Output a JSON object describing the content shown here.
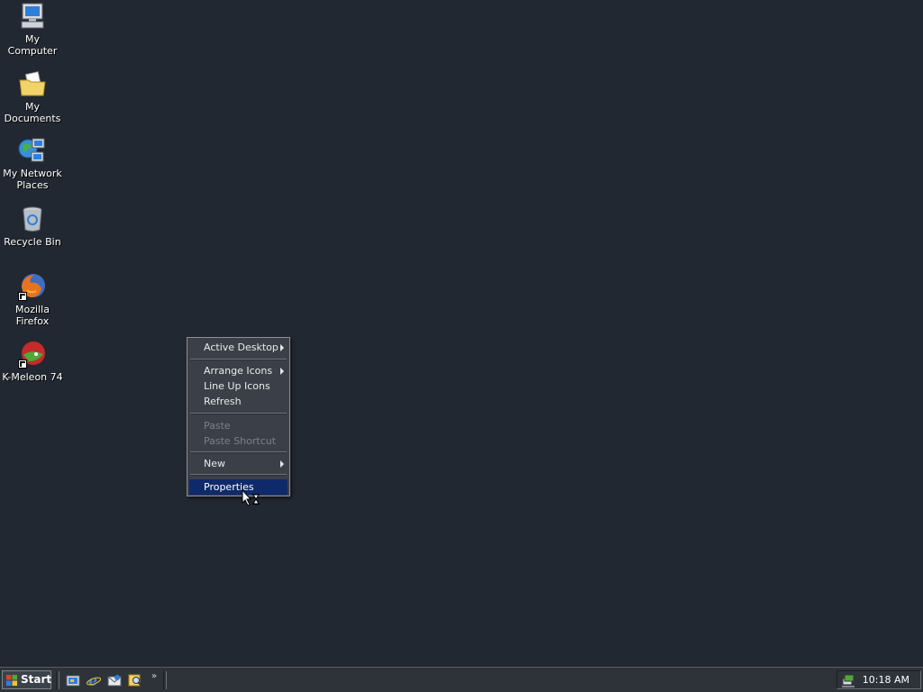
{
  "desktop": {
    "icons": [
      {
        "label": "My Computer",
        "icon": "computer-icon"
      },
      {
        "label": "My Documents",
        "icon": "folder-documents-icon"
      },
      {
        "label": "My Network Places",
        "icon": "network-places-icon"
      },
      {
        "label": "Recycle Bin",
        "icon": "recycle-bin-icon"
      },
      {
        "label": "Mozilla Firefox",
        "icon": "firefox-icon",
        "shortcut": true
      },
      {
        "label": "K-Meleon 74",
        "icon": "kmeleon-icon",
        "shortcut": true
      }
    ]
  },
  "context_menu": {
    "items": [
      {
        "label": "Active Desktop",
        "submenu": true,
        "enabled": true
      },
      {
        "label": "Arrange Icons",
        "submenu": true,
        "enabled": true
      },
      {
        "label": "Line Up Icons",
        "enabled": true
      },
      {
        "label": "Refresh",
        "enabled": true
      },
      {
        "label": "Paste",
        "enabled": false
      },
      {
        "label": "Paste Shortcut",
        "enabled": false
      },
      {
        "label": "New",
        "submenu": true,
        "enabled": true
      },
      {
        "label": "Properties",
        "enabled": true,
        "highlighted": true
      }
    ]
  },
  "taskbar": {
    "start_label": "Start",
    "quick_launch": [
      "show-desktop-icon",
      "internet-explorer-icon",
      "outlook-express-icon",
      "search-icon"
    ],
    "overflow": "»",
    "clock": "10:18 AM"
  },
  "colors": {
    "desktop": "#222831",
    "menu_bg": "#3b4048",
    "highlight": "#0f2a6b",
    "disabled_text": "#7b8088"
  }
}
